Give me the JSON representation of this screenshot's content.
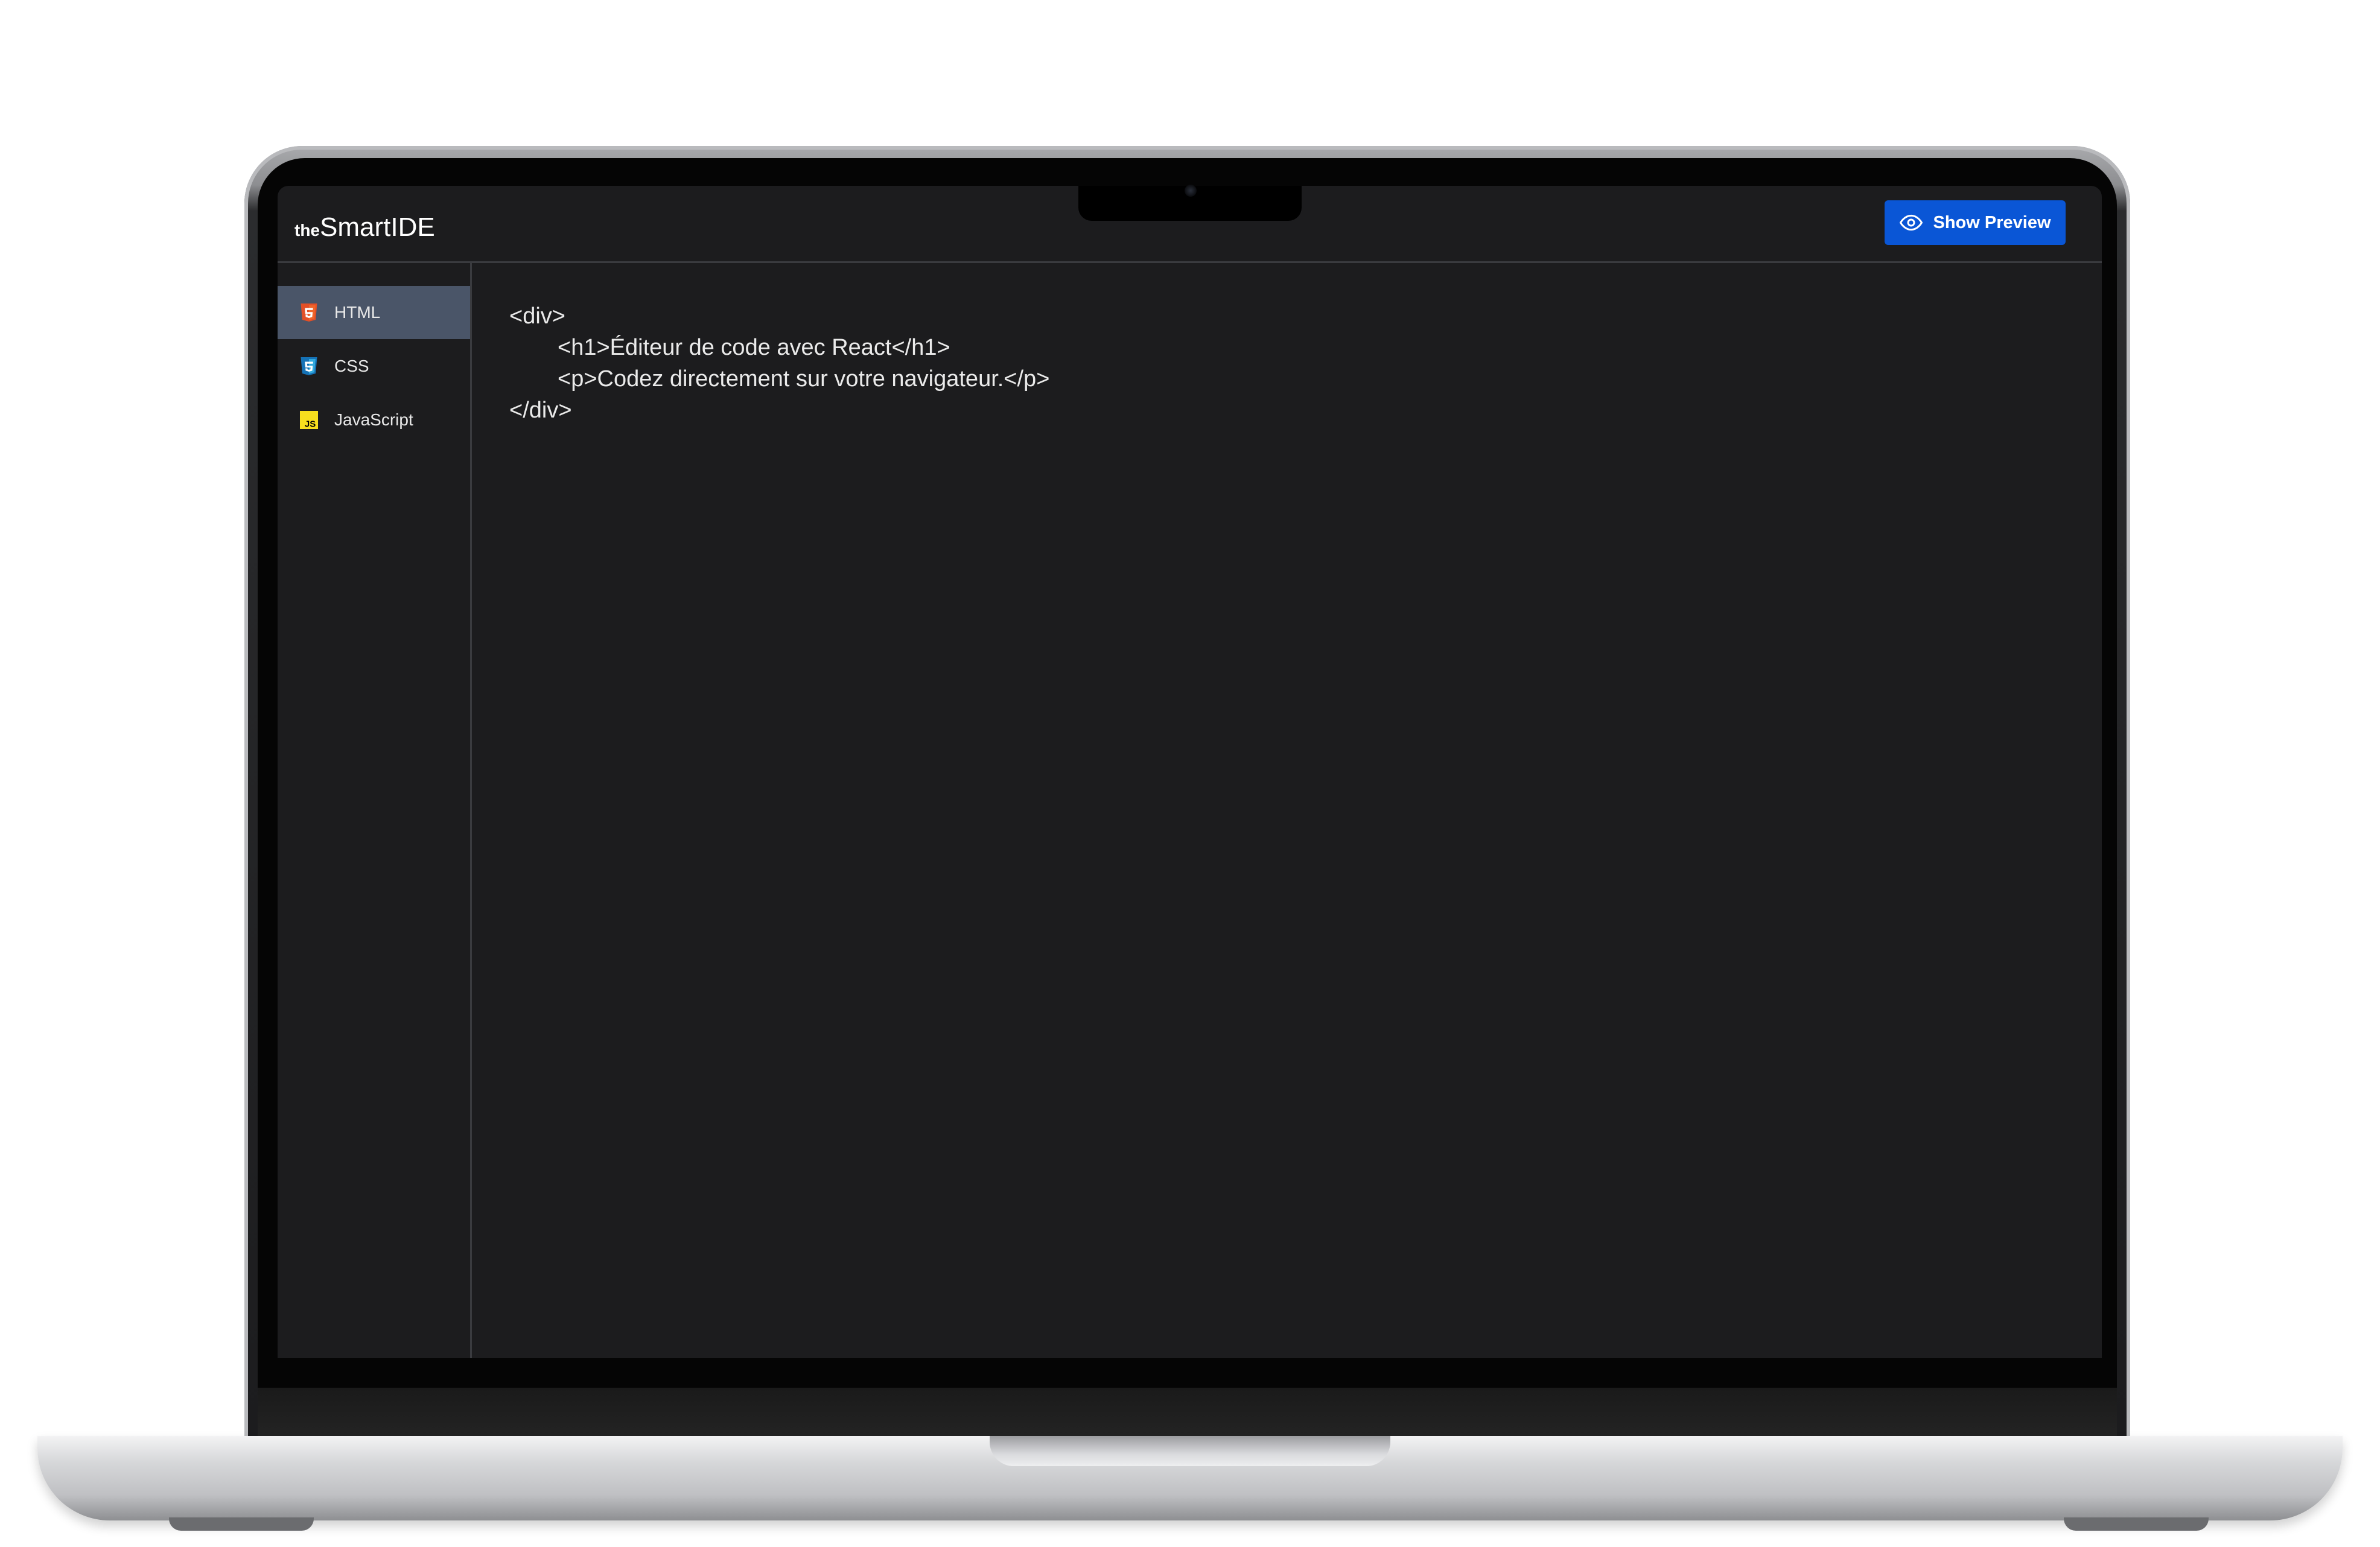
{
  "app": {
    "logo_prefix": "the",
    "logo_name": "SmartIDE"
  },
  "toolbar": {
    "preview_label": "Show Preview",
    "preview_icon": "eye-icon",
    "accent_color": "#0a56d6"
  },
  "sidebar": {
    "items": [
      {
        "label": "HTML",
        "icon": "html5-icon",
        "active": true
      },
      {
        "label": "CSS",
        "icon": "css3-icon",
        "active": false
      },
      {
        "label": "JavaScript",
        "icon": "js-icon",
        "active": false
      }
    ]
  },
  "editor": {
    "language": "HTML",
    "lines": [
      "<div>",
      "<h1>Éditeur de code avec React</h1>",
      "<p>Codez directement sur votre navigateur.</p>",
      "</div>"
    ]
  }
}
